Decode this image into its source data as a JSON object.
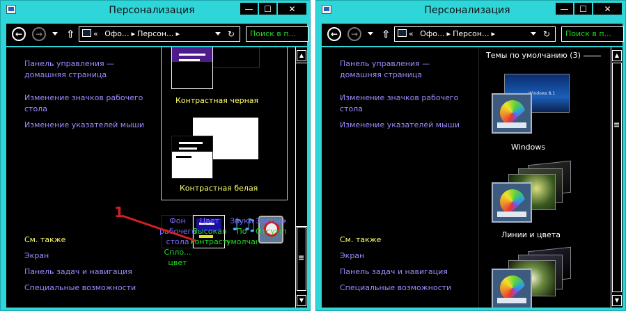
{
  "left_window": {
    "title": "Персонализация",
    "controls": {
      "minimize": "—",
      "maximize": "☐",
      "close": "✕"
    },
    "address": {
      "prefix": "«",
      "crumb1": "Офо...",
      "crumb2": "Персон...",
      "search_placeholder": "Поиск в п..."
    },
    "nav_links": [
      "Панель управления —",
      "домашняя страница",
      "Изменение значков рабочего",
      "стола",
      "Изменение указателей мыши"
    ],
    "see_also": {
      "heading": "См. также",
      "links": [
        "Экран",
        "Панель задач и навигация",
        "Специальные возможности"
      ]
    },
    "themes": {
      "black_label": "Контрастная черная",
      "white_label": "Контрастная белая"
    },
    "customize": {
      "background": {
        "line1": "Фон",
        "line2": "рабочего",
        "line3": "стола",
        "line4": "Спло...",
        "line5": "цвет"
      },
      "color": {
        "line1": "Цвет",
        "line2": "Высокая",
        "line3": "контрастность"
      },
      "sounds": {
        "line1": "Звуки",
        "line2": "По",
        "line3": "умолчани"
      },
      "saver": {
        "line1": "Заставка",
        "line2": "Отсутствует"
      }
    },
    "annotation": "1"
  },
  "right_window": {
    "title": "Персонализация",
    "controls": {
      "minimize": "—",
      "maximize": "☐",
      "close": "✕"
    },
    "address": {
      "prefix": "«",
      "crumb1": "Офо...",
      "crumb2": "Персон...",
      "search_placeholder": "Поиск в п..."
    },
    "nav_links": [
      "Панель управления —",
      "домашняя страница",
      "Изменение значков рабочего",
      "стола",
      "Изменение указателей мыши"
    ],
    "see_also": {
      "heading": "См. также",
      "links": [
        "Экран",
        "Панель задач и навигация",
        "Специальные возможности"
      ]
    },
    "themes_heading": "Темы по умолчанию (3)",
    "preview_text": "Windows 8.1",
    "theme_labels": [
      "Windows",
      "Линии и цвета"
    ]
  },
  "icons": {
    "back": "←",
    "forward": "→",
    "up": "⇧",
    "refresh": "↻",
    "scroll_up": "▲",
    "scroll_down": "▼",
    "grip": "≡",
    "sounds": "♪♫"
  },
  "colors": {
    "frame": "#2ed6d9",
    "link": "#9c8cff",
    "see_also": "#ffff64",
    "search": "#22dd22"
  }
}
